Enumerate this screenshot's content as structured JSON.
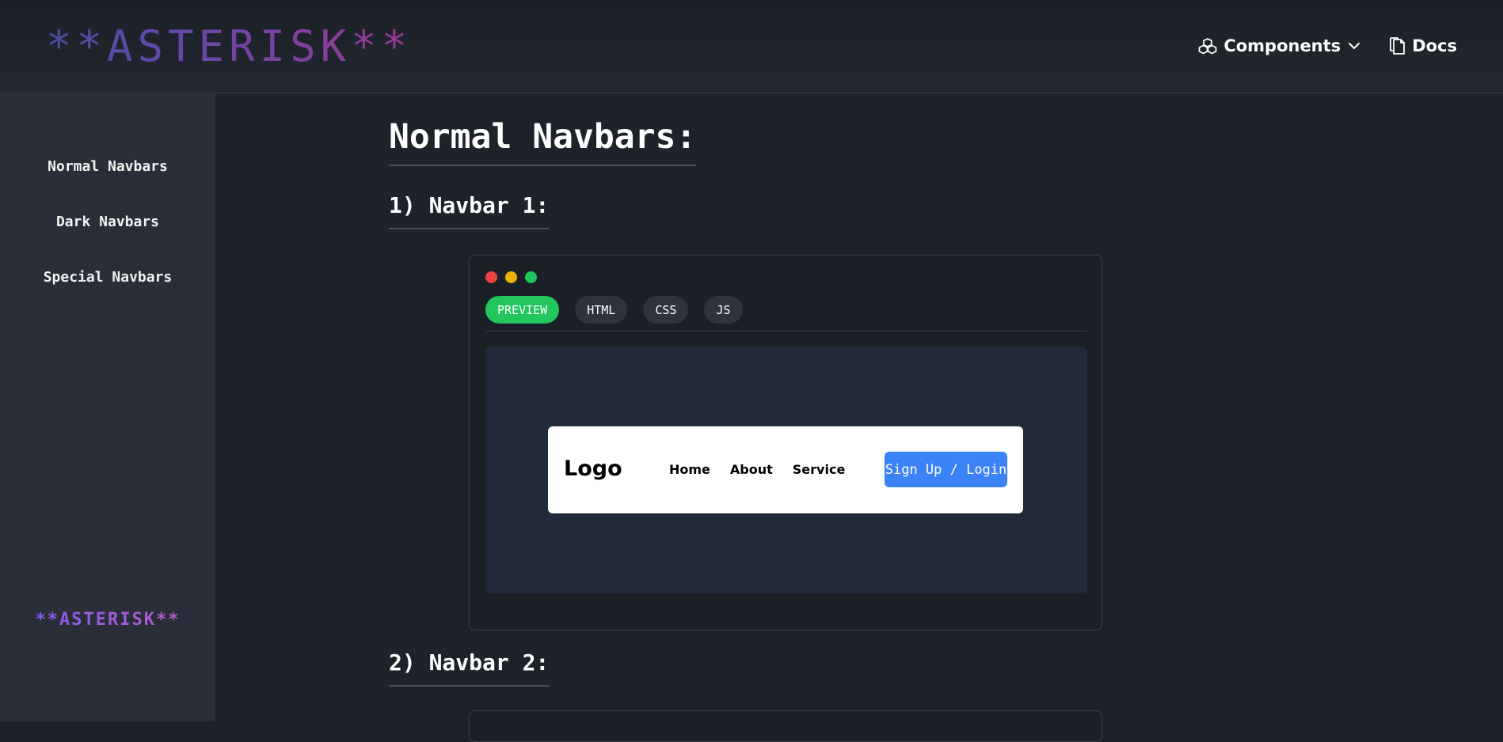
{
  "header": {
    "brand": "**ASTERISK**",
    "nav": [
      {
        "label": "Components",
        "icon": "cubes-icon",
        "has_dropdown": true
      },
      {
        "label": "Docs",
        "icon": "documents-icon"
      }
    ]
  },
  "sidebar": {
    "items": [
      {
        "label": "Normal Navbars"
      },
      {
        "label": "Dark Navbars"
      },
      {
        "label": "Special Navbars"
      }
    ],
    "brand": "**ASTERISK**"
  },
  "main": {
    "title": "Normal Navbars:",
    "sections": [
      {
        "title": "1) Navbar 1:",
        "tabs": [
          {
            "label": "PREVIEW",
            "active": true
          },
          {
            "label": "HTML",
            "active": false
          },
          {
            "label": "CSS",
            "active": false
          },
          {
            "label": "JS",
            "active": false
          }
        ],
        "window_dots": [
          "#ef4444",
          "#eab308",
          "#22c55e"
        ],
        "preview": {
          "logo": "Logo",
          "links": [
            "Home",
            "About",
            "Service"
          ],
          "button": "Sign Up / Login"
        }
      },
      {
        "title": "2) Navbar 2:"
      }
    ]
  },
  "colors": {
    "accent_green": "#22c55e",
    "accent_blue": "#3b82f6",
    "background": "#1e222a",
    "sidebar": "#2a2e38"
  }
}
